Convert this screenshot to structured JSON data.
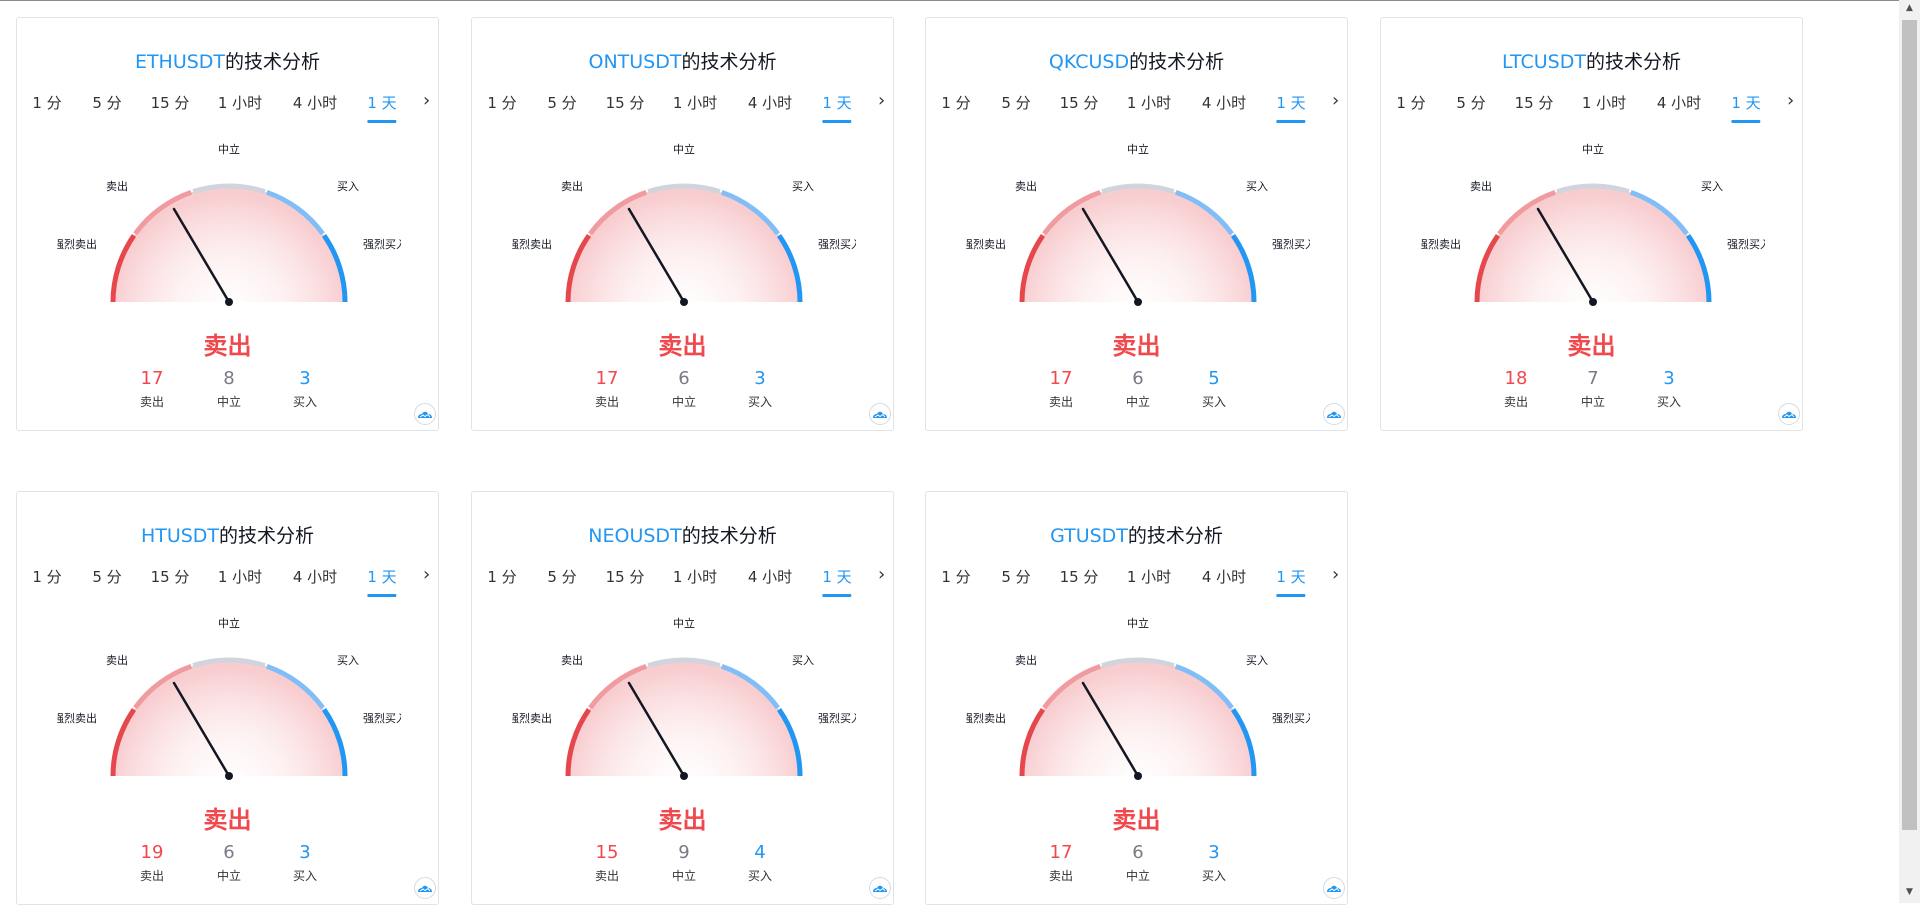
{
  "suffix": "的技术分析",
  "tabs": [
    "1 分",
    "5 分",
    "15 分",
    "1 小时",
    "4 小时",
    "1 天"
  ],
  "active_tab": "1 天",
  "gauge_labels": {
    "strong_sell": "强烈卖出",
    "sell": "卖出",
    "neutral": "中立",
    "buy": "买入",
    "strong_buy": "强烈买入"
  },
  "count_labels": {
    "sell": "卖出",
    "neutral": "中立",
    "buy": "买入"
  },
  "colors": {
    "accent": "#2196f3",
    "sell": "#f0484c",
    "neutral": "#787b86",
    "buy": "#2196f3",
    "arc_strong_sell": "#e5474d",
    "arc_sell": "#f09ba0",
    "arc_neutral": "#d1d4dc",
    "arc_buy": "#81bef7",
    "arc_strong_buy": "#2196f3"
  },
  "cards": [
    {
      "symbol": "ETHUSDT",
      "verdict": "卖出",
      "sell": 17,
      "neutral": 8,
      "buy": 3
    },
    {
      "symbol": "ONTUSDT",
      "verdict": "卖出",
      "sell": 17,
      "neutral": 6,
      "buy": 3
    },
    {
      "symbol": "QKCUSD",
      "verdict": "卖出",
      "sell": 17,
      "neutral": 6,
      "buy": 5
    },
    {
      "symbol": "LTCUSDT",
      "verdict": "卖出",
      "sell": 18,
      "neutral": 7,
      "buy": 3
    },
    {
      "symbol": "HTUSDT",
      "verdict": "卖出",
      "sell": 19,
      "neutral": 6,
      "buy": 3
    },
    {
      "symbol": "NEOUSDT",
      "verdict": "卖出",
      "sell": 15,
      "neutral": 9,
      "buy": 4
    },
    {
      "symbol": "GTUSDT",
      "verdict": "卖出",
      "sell": 17,
      "neutral": 6,
      "buy": 3
    }
  ],
  "icons": {
    "next_tab": "chevron-right-icon",
    "logo": "cloud-logo-icon"
  },
  "scroll_up_glyph": "▲",
  "scroll_down_glyph": "▼"
}
